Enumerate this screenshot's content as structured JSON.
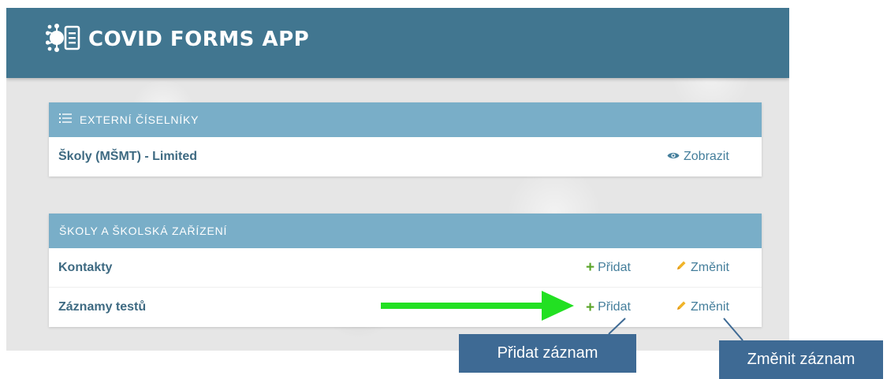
{
  "app": {
    "title": "COVID FORMS APP"
  },
  "modules": [
    {
      "title": "EXTERNÍ ČÍSELNÍKY",
      "rows": [
        {
          "label": "Školy (MŠMT) - Limited",
          "view_label": "Zobrazit"
        }
      ]
    },
    {
      "title": "ŠKOLY A ŠKOLSKÁ ZAŘÍZENÍ",
      "rows": [
        {
          "label": "Kontakty",
          "add_label": "Přidat",
          "change_label": "Změnit"
        },
        {
          "label": "Záznamy testů",
          "add_label": "Přidat",
          "change_label": "Změnit"
        }
      ]
    }
  ],
  "callouts": {
    "add": "Přidat záznam",
    "change": "Změnit záznam"
  },
  "colors": {
    "header": "#417690",
    "module_header": "#79aec8",
    "link": "#447e9b",
    "add_green": "#5aa428",
    "arrow_green": "#22e022",
    "callout": "#3e6a94"
  },
  "icons": {
    "logo": "virus-form-icon",
    "module1": "list-icon",
    "view": "eye-icon",
    "add": "plus-icon",
    "change": "pencil-icon"
  }
}
